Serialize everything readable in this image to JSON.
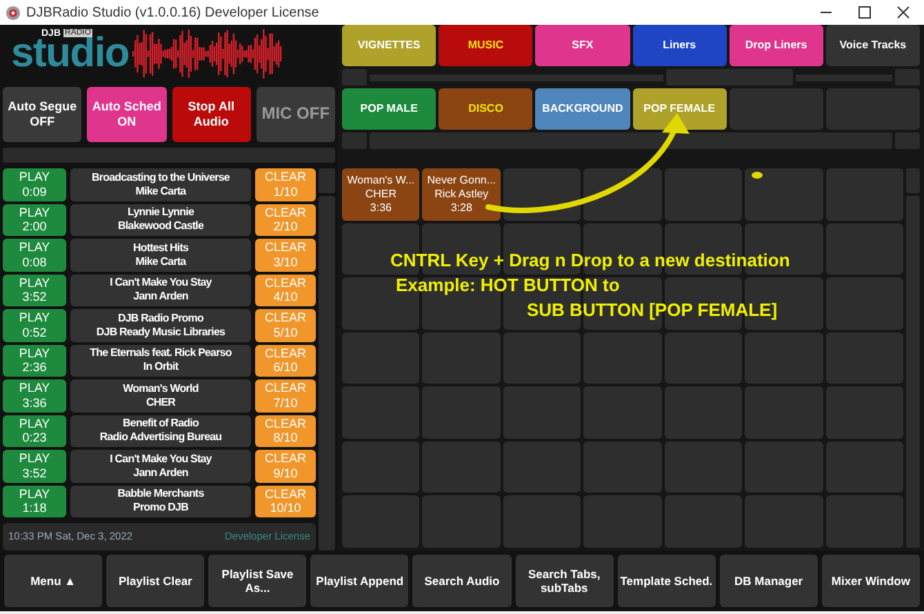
{
  "window": {
    "title": "DJBRadio Studio (v1.0.0.16) Developer License"
  },
  "logo": {
    "brand": "DJB",
    "badge": "RADIO",
    "name": "studio"
  },
  "controls": [
    {
      "line1": "Auto Segue",
      "line2": "OFF",
      "color": "#3a3a3a",
      "kind": "toggle"
    },
    {
      "line1": "Auto Sched",
      "line2": "ON",
      "color": "#e0358c",
      "kind": "toggle"
    },
    {
      "line1": "Stop All",
      "line2": "Audio",
      "color": "#bb0a0a",
      "kind": "toggle"
    },
    {
      "line1": "MIC OFF",
      "color": "#3a3a3a",
      "kind": "mic"
    }
  ],
  "playlist": [
    {
      "play": "PLAY",
      "time": "0:09",
      "title": "Broadcasting to the Universe",
      "artist": "Mike Carta",
      "clear": "CLEAR",
      "count": "1/10"
    },
    {
      "play": "PLAY",
      "time": "2:00",
      "title": "Lynnie Lynnie",
      "artist": "Blakewood Castle",
      "clear": "CLEAR",
      "count": "2/10"
    },
    {
      "play": "PLAY",
      "time": "0:08",
      "title": "Hottest Hits",
      "artist": "Mike Carta",
      "clear": "CLEAR",
      "count": "3/10"
    },
    {
      "play": "PLAY",
      "time": "3:52",
      "title": "I Can't Make You Stay",
      "artist": "Jann Arden",
      "clear": "CLEAR",
      "count": "4/10"
    },
    {
      "play": "PLAY",
      "time": "0:52",
      "title": "DJB Radio Promo",
      "artist": "DJB Ready Music Libraries",
      "clear": "CLEAR",
      "count": "5/10"
    },
    {
      "play": "PLAY",
      "time": "2:36",
      "title": "The Eternals feat. Rick Pearso",
      "artist": "In Orbit",
      "clear": "CLEAR",
      "count": "6/10"
    },
    {
      "play": "PLAY",
      "time": "3:36",
      "title": "Woman's World",
      "artist": "CHER",
      "clear": "CLEAR",
      "count": "7/10"
    },
    {
      "play": "PLAY",
      "time": "0:23",
      "title": "Benefit of Radio",
      "artist": "Radio Advertising Bureau",
      "clear": "CLEAR",
      "count": "8/10"
    },
    {
      "play": "PLAY",
      "time": "3:52",
      "title": "I Can't Make You Stay",
      "artist": "Jann Arden",
      "clear": "CLEAR",
      "count": "9/10"
    },
    {
      "play": "PLAY",
      "time": "1:18",
      "title": "Babble Merchants",
      "artist": "Promo DJB",
      "clear": "CLEAR",
      "count": "10/10"
    }
  ],
  "status": {
    "datetime": "10:33 PM Sat, Dec 3, 2022",
    "license": "Developer License"
  },
  "tabs": [
    {
      "label": "VIGNETTES",
      "color": "#aea22a",
      "highlighted": false
    },
    {
      "label": "MUSIC",
      "color": "#b80c0c",
      "highlighted": true
    },
    {
      "label": "SFX",
      "color": "#e0358c",
      "highlighted": false
    },
    {
      "label": "Liners",
      "color": "#1f44c4",
      "highlighted": false
    },
    {
      "label": "Drop Liners",
      "color": "#e0358c",
      "highlighted": false
    },
    {
      "label": "Voice Tracks",
      "color": "#333333",
      "highlighted": false
    }
  ],
  "sub_tabs": [
    {
      "kind": "label",
      "label": "POP MALE",
      "color": "#1e8a3e",
      "highlighted": false
    },
    {
      "kind": "label",
      "label": "DISCO",
      "color": "#8b4513",
      "highlighted": true
    },
    {
      "kind": "label",
      "label": "BACKGROUND",
      "color": "#4f86bb",
      "highlighted": false
    },
    {
      "kind": "label",
      "label": "POP FEMALE",
      "color": "#aea22a",
      "highlighted": false
    },
    {
      "kind": "empty"
    },
    {
      "kind": "empty"
    }
  ],
  "hot_buttons": [
    {
      "kind": "track",
      "title": "Woman's W...",
      "artist": "CHER",
      "time": "3:36"
    },
    {
      "kind": "track",
      "title": "Never Gonn...",
      "artist": "Rick Astley",
      "time": "3:28"
    },
    {
      "kind": "empty"
    },
    {
      "kind": "empty"
    },
    {
      "kind": "empty"
    },
    {
      "kind": "empty"
    },
    {
      "kind": "empty"
    },
    {
      "kind": "empty"
    },
    {
      "kind": "empty"
    },
    {
      "kind": "empty"
    },
    {
      "kind": "empty"
    },
    {
      "kind": "empty"
    },
    {
      "kind": "empty"
    },
    {
      "kind": "empty"
    },
    {
      "kind": "empty"
    },
    {
      "kind": "empty"
    },
    {
      "kind": "empty"
    },
    {
      "kind": "empty"
    },
    {
      "kind": "empty"
    },
    {
      "kind": "empty"
    },
    {
      "kind": "empty"
    },
    {
      "kind": "empty"
    },
    {
      "kind": "empty"
    },
    {
      "kind": "empty"
    },
    {
      "kind": "empty"
    },
    {
      "kind": "empty"
    },
    {
      "kind": "empty"
    },
    {
      "kind": "empty"
    },
    {
      "kind": "empty"
    },
    {
      "kind": "empty"
    },
    {
      "kind": "empty"
    },
    {
      "kind": "empty"
    },
    {
      "kind": "empty"
    },
    {
      "kind": "empty"
    },
    {
      "kind": "empty"
    },
    {
      "kind": "empty"
    },
    {
      "kind": "empty"
    },
    {
      "kind": "empty"
    },
    {
      "kind": "empty"
    },
    {
      "kind": "empty"
    },
    {
      "kind": "empty"
    },
    {
      "kind": "empty"
    },
    {
      "kind": "empty"
    },
    {
      "kind": "empty"
    },
    {
      "kind": "empty"
    },
    {
      "kind": "empty"
    },
    {
      "kind": "empty"
    },
    {
      "kind": "empty"
    },
    {
      "kind": "empty"
    }
  ],
  "annotation": {
    "line1": "CNTRL Key + Drag n Drop to a new destination",
    "line2": "Example: HOT BUTTON to",
    "line3": "SUB BUTTON  [POP FEMALE]"
  },
  "toolbar": [
    {
      "label": "Menu ▲"
    },
    {
      "label": "Playlist Clear"
    },
    {
      "label": "Playlist Save As..."
    },
    {
      "label": "Playlist Append"
    },
    {
      "label": "Search Audio"
    },
    {
      "label": "Search Tabs, subTabs"
    },
    {
      "label": "Template Sched."
    },
    {
      "label": "DB Manager"
    },
    {
      "label": "Mixer Window"
    }
  ]
}
